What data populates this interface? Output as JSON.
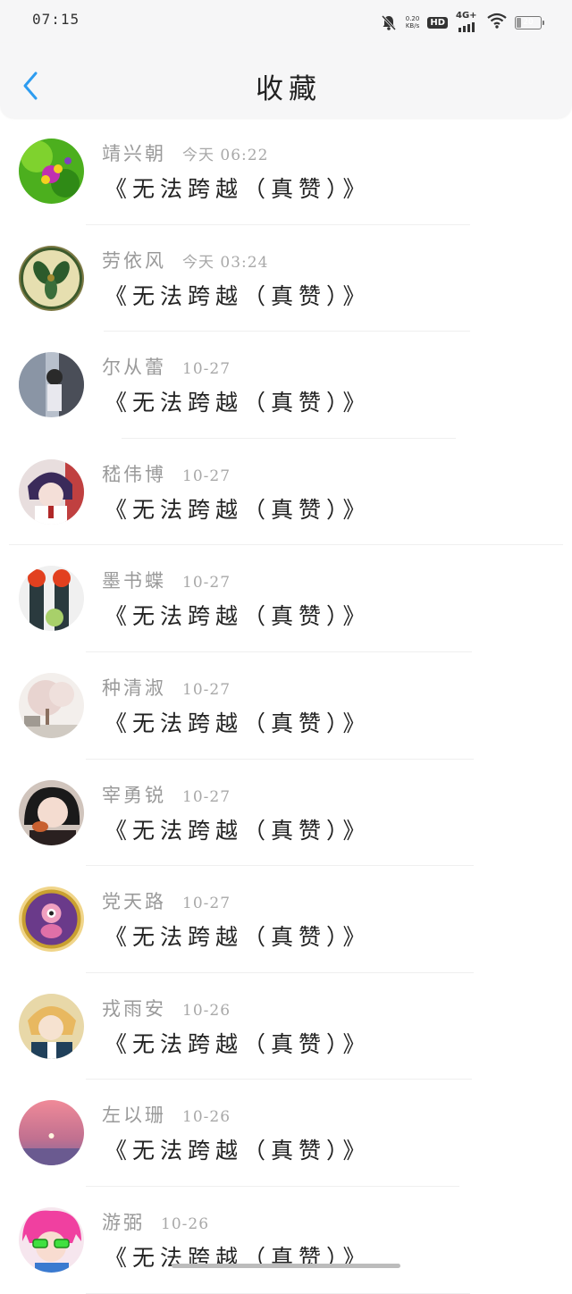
{
  "status_bar": {
    "time": "07:15",
    "net_speed_value": "0.20",
    "net_speed_unit": "KB/s",
    "hd_label": "HD",
    "network_label": "4G+",
    "battery_level": "20",
    "icons": [
      "bell-muted-icon",
      "hd-icon",
      "signal-4g-icon",
      "wifi-icon",
      "battery-icon"
    ]
  },
  "header": {
    "title": "收藏",
    "back_icon": "chevron-left-icon",
    "accent_color": "#2d9cf0"
  },
  "favorites": [
    {
      "name": "靖兴朝",
      "time": "今天 06:22",
      "content": "《无法跨越（真赞）》",
      "avatar": "avatar-green-flowers"
    },
    {
      "name": "劳依风",
      "time": "今天 03:24",
      "content": "《无法跨越（真赞）》",
      "avatar": "avatar-botanical-plate"
    },
    {
      "name": "尔从蕾",
      "time": "10-27",
      "content": "《无法跨越（真赞）》",
      "avatar": "avatar-girl-window"
    },
    {
      "name": "嵇伟博",
      "time": "10-27",
      "content": "《无法跨越（真赞）》",
      "avatar": "avatar-anime-boy"
    },
    {
      "name": "墨书蝶",
      "time": "10-27",
      "content": "《无法跨越（真赞）》",
      "avatar": "avatar-cactus"
    },
    {
      "name": "种清淑",
      "time": "10-27",
      "content": "《无法跨越（真赞）》",
      "avatar": "avatar-blossom-tree"
    },
    {
      "name": "宰勇锐",
      "time": "10-27",
      "content": "《无法跨越（真赞）》",
      "avatar": "avatar-girl-eating"
    },
    {
      "name": "党天路",
      "time": "10-27",
      "content": "《无法跨越（真赞）》",
      "avatar": "avatar-gold-coin"
    },
    {
      "name": "戎雨安",
      "time": "10-26",
      "content": "《无法跨越（真赞）》",
      "avatar": "avatar-anime-blonde"
    },
    {
      "name": "左以珊",
      "time": "10-26",
      "content": "《无法跨越（真赞）》",
      "avatar": "avatar-sunset-sea"
    },
    {
      "name": "游弼",
      "time": "10-26",
      "content": "《无法跨越（真赞）》",
      "avatar": "avatar-pink-hair-glasses"
    }
  ]
}
